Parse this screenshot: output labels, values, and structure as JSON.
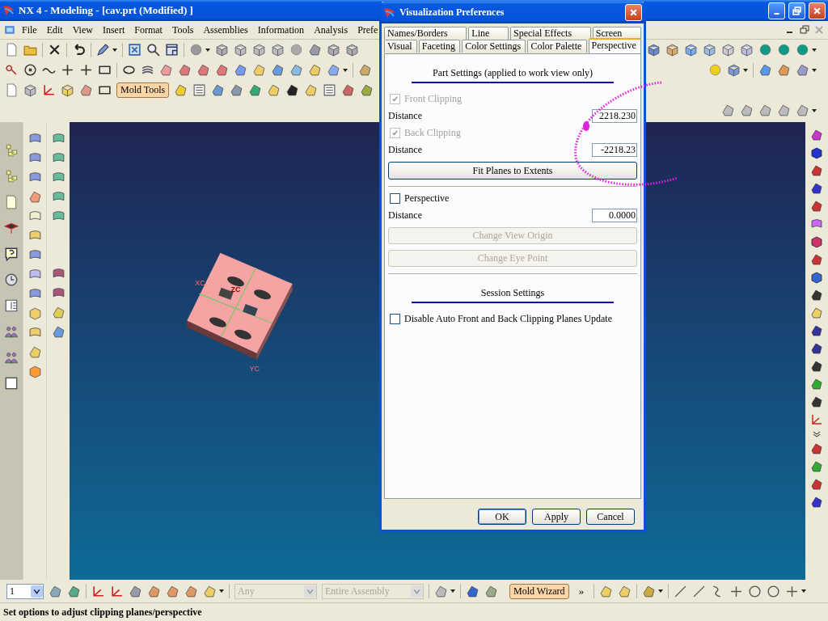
{
  "window": {
    "title": "NX 4 - Modeling - [cav.prt (Modified) ]"
  },
  "menu": [
    "File",
    "Edit",
    "View",
    "Insert",
    "Format",
    "Tools",
    "Assemblies",
    "Information",
    "Analysis",
    "Prefe"
  ],
  "toolbar": {
    "mold_tools": "Mold Tools"
  },
  "graphics": {
    "axis_labels": [
      "XC",
      "ZC",
      "YC"
    ]
  },
  "dialog": {
    "title": "Visualization Preferences",
    "tab_rows": [
      [
        {
          "label": "Names/Borders",
          "selected": false
        },
        {
          "label": "Line",
          "selected": false
        },
        {
          "label": "Special Effects",
          "selected": false
        },
        {
          "label": "Screen",
          "selected": false
        }
      ],
      [
        {
          "label": "Visual",
          "selected": false
        },
        {
          "label": "Faceting",
          "selected": false
        },
        {
          "label": "Color Settings",
          "selected": false
        },
        {
          "label": "Color Palette",
          "selected": false
        },
        {
          "label": "Perspective",
          "selected": true
        }
      ]
    ],
    "part_heading": "Part Settings (applied to work view only)",
    "clipping": [
      {
        "label": "Front Clipping",
        "checked": true,
        "disabled": true,
        "distance_label": "Distance",
        "distance": "2218.230"
      },
      {
        "label": "Back Clipping",
        "checked": true,
        "disabled": true,
        "distance_label": "Distance",
        "distance": "-2218.23"
      }
    ],
    "fit_button": "Fit Planes to Extents",
    "perspective": {
      "label": "Perspective",
      "checked": false,
      "distance_label": "Distance",
      "distance": "0.0000"
    },
    "view_buttons": [
      {
        "label": "Change View Origin",
        "disabled": true
      },
      {
        "label": "Change Eye Point",
        "disabled": true
      }
    ],
    "session_heading": "Session Settings",
    "auto_update": {
      "label": "Disable Auto Front and Back Clipping Planes Update",
      "checked": false
    },
    "buttons": [
      "OK",
      "Apply",
      "Cancel"
    ]
  },
  "selection_bar": {
    "view_count": "1",
    "filter": {
      "value": "Any",
      "disabled": true
    },
    "scope": {
      "value": "Entire Assembly",
      "disabled": true
    },
    "mold_wizard": "Mold Wizard",
    "more": "»"
  },
  "status_bar": "Set options to adjust clipping planes/perspective"
}
